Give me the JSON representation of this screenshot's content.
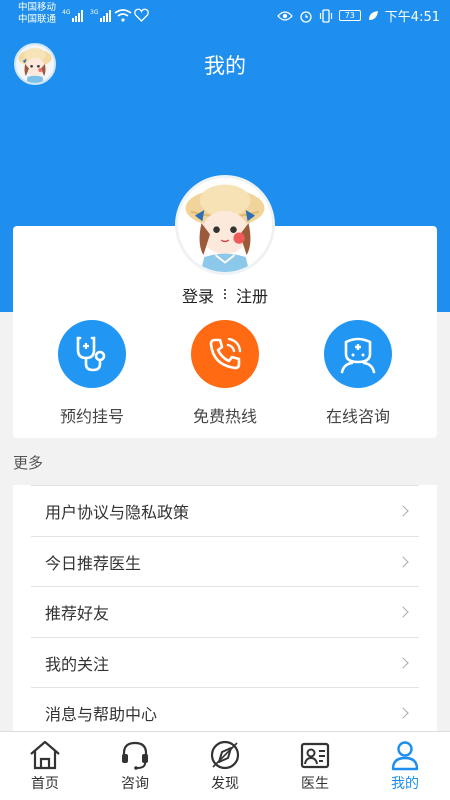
{
  "status_bar": {
    "carrier_1": "中国移动",
    "carrier_2": "中国联通",
    "network_1": "4G",
    "network_2": "3G",
    "battery": "73",
    "time": "下午4:51"
  },
  "header": {
    "title": "我的"
  },
  "profile": {
    "login": "登录",
    "register": "注册"
  },
  "quick_actions": [
    {
      "label": "预约挂号",
      "icon": "stethoscope-icon",
      "color": "#2196f3"
    },
    {
      "label": "免费热线",
      "icon": "phone-icon",
      "color": "#ff6a13"
    },
    {
      "label": "在线咨询",
      "icon": "doctor-icon",
      "color": "#2196f3"
    }
  ],
  "more": {
    "title": "更多",
    "items": [
      {
        "label": "用户协议与隐私政策"
      },
      {
        "label": "今日推荐医生"
      },
      {
        "label": "推荐好友"
      },
      {
        "label": "我的关注"
      },
      {
        "label": "消息与帮助中心"
      }
    ]
  },
  "tabbar": {
    "tabs": [
      {
        "label": "首页",
        "icon": "home-icon"
      },
      {
        "label": "咨询",
        "icon": "headset-icon"
      },
      {
        "label": "发现",
        "icon": "compass-icon"
      },
      {
        "label": "医生",
        "icon": "doctor-card-icon"
      },
      {
        "label": "我的",
        "icon": "person-icon",
        "active": true
      }
    ]
  },
  "colors": {
    "primary": "#1e8fef",
    "hotline": "#ff6a13",
    "background": "#f2f2f2"
  }
}
